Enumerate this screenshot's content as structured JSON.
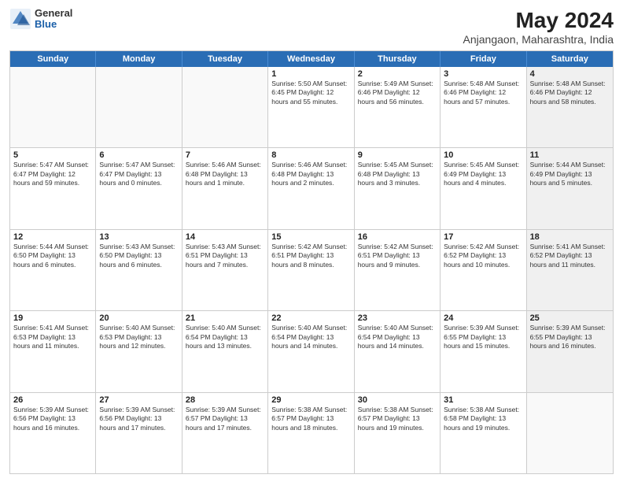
{
  "header": {
    "logo_general": "General",
    "logo_blue": "Blue",
    "month_year": "May 2024",
    "location": "Anjangaon, Maharashtra, India"
  },
  "days_of_week": [
    "Sunday",
    "Monday",
    "Tuesday",
    "Wednesday",
    "Thursday",
    "Friday",
    "Saturday"
  ],
  "rows": [
    [
      {
        "day": "",
        "info": ""
      },
      {
        "day": "",
        "info": ""
      },
      {
        "day": "",
        "info": ""
      },
      {
        "day": "1",
        "info": "Sunrise: 5:50 AM\nSunset: 6:45 PM\nDaylight: 12 hours\nand 55 minutes."
      },
      {
        "day": "2",
        "info": "Sunrise: 5:49 AM\nSunset: 6:46 PM\nDaylight: 12 hours\nand 56 minutes."
      },
      {
        "day": "3",
        "info": "Sunrise: 5:48 AM\nSunset: 6:46 PM\nDaylight: 12 hours\nand 57 minutes."
      },
      {
        "day": "4",
        "info": "Sunrise: 5:48 AM\nSunset: 6:46 PM\nDaylight: 12 hours\nand 58 minutes."
      }
    ],
    [
      {
        "day": "5",
        "info": "Sunrise: 5:47 AM\nSunset: 6:47 PM\nDaylight: 12 hours\nand 59 minutes."
      },
      {
        "day": "6",
        "info": "Sunrise: 5:47 AM\nSunset: 6:47 PM\nDaylight: 13 hours\nand 0 minutes."
      },
      {
        "day": "7",
        "info": "Sunrise: 5:46 AM\nSunset: 6:48 PM\nDaylight: 13 hours\nand 1 minute."
      },
      {
        "day": "8",
        "info": "Sunrise: 5:46 AM\nSunset: 6:48 PM\nDaylight: 13 hours\nand 2 minutes."
      },
      {
        "day": "9",
        "info": "Sunrise: 5:45 AM\nSunset: 6:48 PM\nDaylight: 13 hours\nand 3 minutes."
      },
      {
        "day": "10",
        "info": "Sunrise: 5:45 AM\nSunset: 6:49 PM\nDaylight: 13 hours\nand 4 minutes."
      },
      {
        "day": "11",
        "info": "Sunrise: 5:44 AM\nSunset: 6:49 PM\nDaylight: 13 hours\nand 5 minutes."
      }
    ],
    [
      {
        "day": "12",
        "info": "Sunrise: 5:44 AM\nSunset: 6:50 PM\nDaylight: 13 hours\nand 6 minutes."
      },
      {
        "day": "13",
        "info": "Sunrise: 5:43 AM\nSunset: 6:50 PM\nDaylight: 13 hours\nand 6 minutes."
      },
      {
        "day": "14",
        "info": "Sunrise: 5:43 AM\nSunset: 6:51 PM\nDaylight: 13 hours\nand 7 minutes."
      },
      {
        "day": "15",
        "info": "Sunrise: 5:42 AM\nSunset: 6:51 PM\nDaylight: 13 hours\nand 8 minutes."
      },
      {
        "day": "16",
        "info": "Sunrise: 5:42 AM\nSunset: 6:51 PM\nDaylight: 13 hours\nand 9 minutes."
      },
      {
        "day": "17",
        "info": "Sunrise: 5:42 AM\nSunset: 6:52 PM\nDaylight: 13 hours\nand 10 minutes."
      },
      {
        "day": "18",
        "info": "Sunrise: 5:41 AM\nSunset: 6:52 PM\nDaylight: 13 hours\nand 11 minutes."
      }
    ],
    [
      {
        "day": "19",
        "info": "Sunrise: 5:41 AM\nSunset: 6:53 PM\nDaylight: 13 hours\nand 11 minutes."
      },
      {
        "day": "20",
        "info": "Sunrise: 5:40 AM\nSunset: 6:53 PM\nDaylight: 13 hours\nand 12 minutes."
      },
      {
        "day": "21",
        "info": "Sunrise: 5:40 AM\nSunset: 6:54 PM\nDaylight: 13 hours\nand 13 minutes."
      },
      {
        "day": "22",
        "info": "Sunrise: 5:40 AM\nSunset: 6:54 PM\nDaylight: 13 hours\nand 14 minutes."
      },
      {
        "day": "23",
        "info": "Sunrise: 5:40 AM\nSunset: 6:54 PM\nDaylight: 13 hours\nand 14 minutes."
      },
      {
        "day": "24",
        "info": "Sunrise: 5:39 AM\nSunset: 6:55 PM\nDaylight: 13 hours\nand 15 minutes."
      },
      {
        "day": "25",
        "info": "Sunrise: 5:39 AM\nSunset: 6:55 PM\nDaylight: 13 hours\nand 16 minutes."
      }
    ],
    [
      {
        "day": "26",
        "info": "Sunrise: 5:39 AM\nSunset: 6:56 PM\nDaylight: 13 hours\nand 16 minutes."
      },
      {
        "day": "27",
        "info": "Sunrise: 5:39 AM\nSunset: 6:56 PM\nDaylight: 13 hours\nand 17 minutes."
      },
      {
        "day": "28",
        "info": "Sunrise: 5:39 AM\nSunset: 6:57 PM\nDaylight: 13 hours\nand 17 minutes."
      },
      {
        "day": "29",
        "info": "Sunrise: 5:38 AM\nSunset: 6:57 PM\nDaylight: 13 hours\nand 18 minutes."
      },
      {
        "day": "30",
        "info": "Sunrise: 5:38 AM\nSunset: 6:57 PM\nDaylight: 13 hours\nand 19 minutes."
      },
      {
        "day": "31",
        "info": "Sunrise: 5:38 AM\nSunset: 6:58 PM\nDaylight: 13 hours\nand 19 minutes."
      },
      {
        "day": "",
        "info": ""
      }
    ]
  ]
}
